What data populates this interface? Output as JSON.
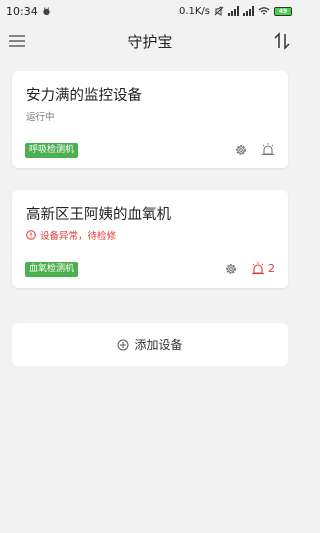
{
  "status_bar": {
    "time": "10:34",
    "network_speed": "0.1K/s",
    "battery": "49"
  },
  "app_bar": {
    "title": "守护宝",
    "left_icon": "menu-icon",
    "right_icon": "sort-icon"
  },
  "colors": {
    "tag_green": "#4caf50",
    "error_red": "#e53935",
    "background": "#f2f2f2"
  },
  "devices": [
    {
      "name": "安力满的监控设备",
      "status": "运行中",
      "status_type": "normal",
      "tag": "呼吸检测机",
      "alarm_count": ""
    },
    {
      "name": "高新区王阿姨的血氧机",
      "status": "设备异常，待检修",
      "status_type": "error",
      "tag": "血氧检测机",
      "alarm_count": "2"
    }
  ],
  "add_device": {
    "label": "添加设备"
  }
}
